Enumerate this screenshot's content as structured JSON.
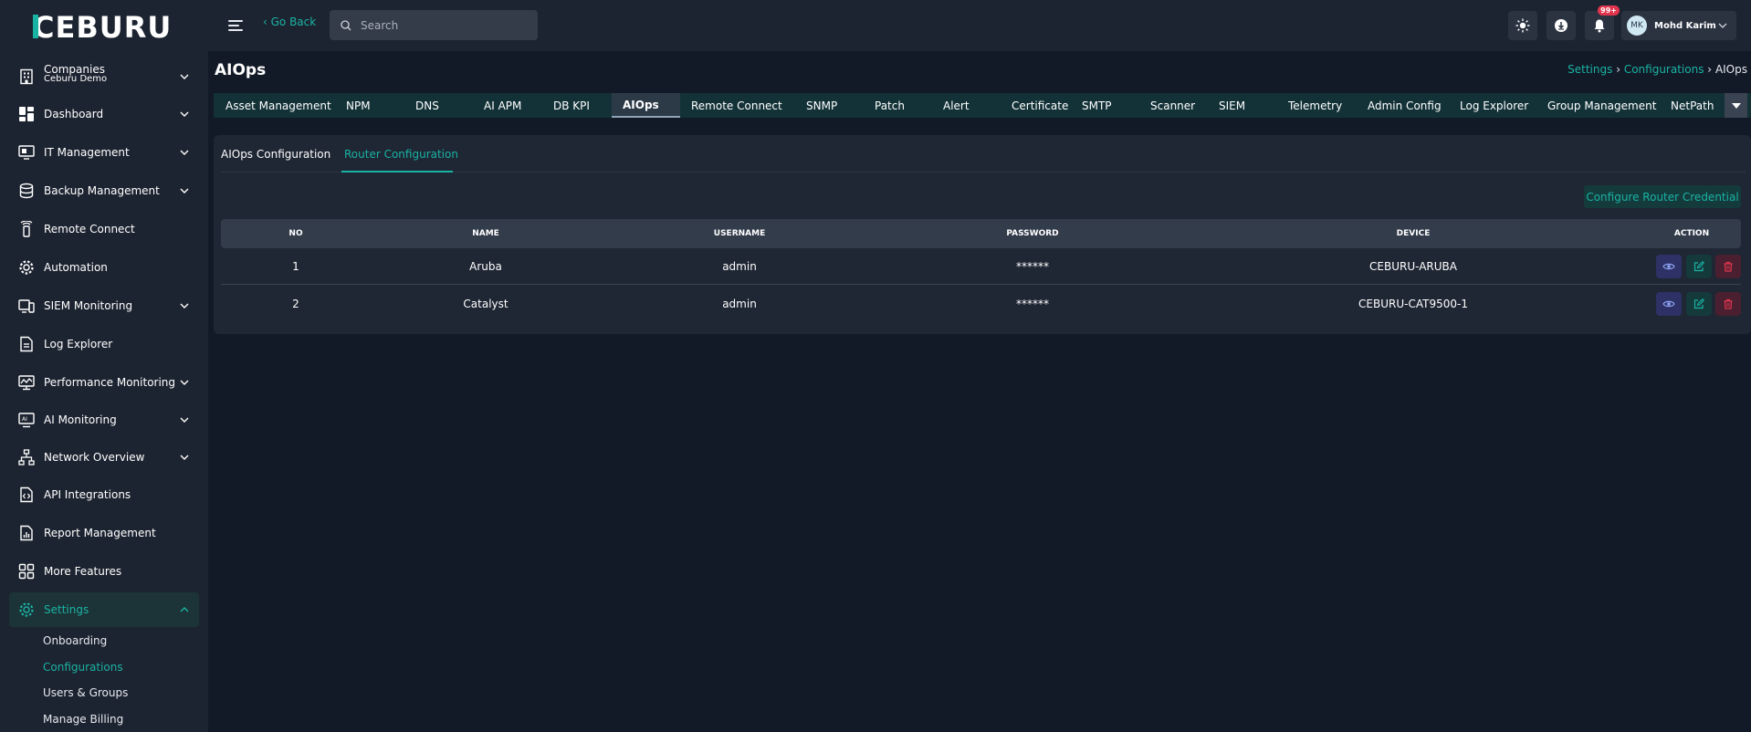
{
  "app": {
    "logo_text": "CEBURU",
    "go_back": "‹ Go Back",
    "search_placeholder": "Search",
    "notification_badge": "99+",
    "user": {
      "initials": "MK",
      "name": "Mohd Karim"
    }
  },
  "sidebar": {
    "company": {
      "label": "Companies",
      "sub": "Ceburu Demo"
    },
    "items": [
      {
        "label": "Dashboard"
      },
      {
        "label": "IT Management"
      },
      {
        "label": "Backup Management"
      },
      {
        "label": "Remote Connect"
      },
      {
        "label": "Automation"
      },
      {
        "label": "SIEM Monitoring"
      },
      {
        "label": "Log Explorer"
      },
      {
        "label": "Performance Monitoring"
      },
      {
        "label": "AI Monitoring"
      },
      {
        "label": "Network Overview"
      },
      {
        "label": "API Integrations"
      },
      {
        "label": "Report Management"
      },
      {
        "label": "More Features"
      },
      {
        "label": "Settings"
      }
    ],
    "settings_sub": [
      {
        "label": "Onboarding"
      },
      {
        "label": "Configurations"
      },
      {
        "label": "Users & Groups"
      },
      {
        "label": "Manage Billing"
      }
    ]
  },
  "page": {
    "title": "AIOps",
    "breadcrumb": [
      "Settings",
      "Configurations",
      "AIOps"
    ],
    "breadcrumb_sep": "›"
  },
  "tabs": [
    "Asset Management",
    "NPM",
    "DNS",
    "AI APM",
    "DB KPI",
    "AIOps",
    "Remote Connect",
    "SNMP",
    "Patch",
    "Alert",
    "Certificate",
    "SMTP",
    "Scanner",
    "SIEM",
    "Telemetry",
    "Admin Config",
    "Log Explorer",
    "Group Management",
    "NetPath"
  ],
  "subtabs": [
    "AIOps Configuration",
    "Router Configuration"
  ],
  "configure_button": "Configure Router Credential",
  "table": {
    "headers": [
      "NO",
      "NAME",
      "USERNAME",
      "PASSWORD",
      "DEVICE",
      "ACTION"
    ],
    "rows": [
      {
        "no": "1",
        "name": "Aruba",
        "username": "admin",
        "password": "******",
        "device": "CEBURU-ARUBA"
      },
      {
        "no": "2",
        "name": "Catalyst",
        "username": "admin",
        "password": "******",
        "device": "CEBURU-CAT9500-1"
      }
    ]
  },
  "colors": {
    "accent": "#19b3a3",
    "background": "#131a27",
    "panel": "#1f2634",
    "badge": "#e1354e"
  }
}
